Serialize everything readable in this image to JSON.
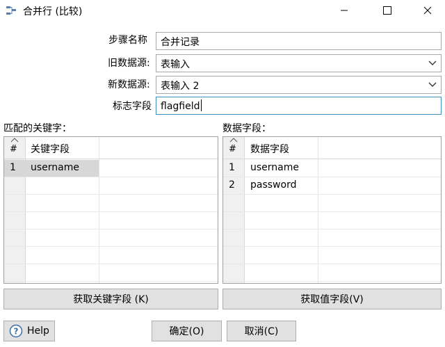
{
  "window": {
    "title": "合并行 (比较)"
  },
  "form": {
    "step_name_label": "步骤名称",
    "step_name_value": "合并记录",
    "old_source_label": "旧数据源:",
    "old_source_value": "表输入",
    "new_source_label": "新数据源:",
    "new_source_value": "表输入 2",
    "flag_field_label": "标志字段",
    "flag_field_value": "flagfield"
  },
  "keys_panel": {
    "title": "匹配的关键字：",
    "index_header": "#",
    "column_header": "关键字段",
    "rows": [
      {
        "index": "1",
        "value": "username"
      }
    ],
    "get_button": "获取关键字段 (K)"
  },
  "values_panel": {
    "title": "数据字段：",
    "index_header": "#",
    "column_header": "数据字段",
    "rows": [
      {
        "index": "1",
        "value": "username"
      },
      {
        "index": "2",
        "value": "password"
      }
    ],
    "get_button": "获取值字段(V)"
  },
  "footer": {
    "help_button": "Help",
    "ok_button": "确定(O)",
    "cancel_button": "取消(C)"
  },
  "colors": {
    "selected_row": "#d7d7d7",
    "button_bg": "#e1e1e1",
    "focus_border": "#3c8dbc"
  }
}
